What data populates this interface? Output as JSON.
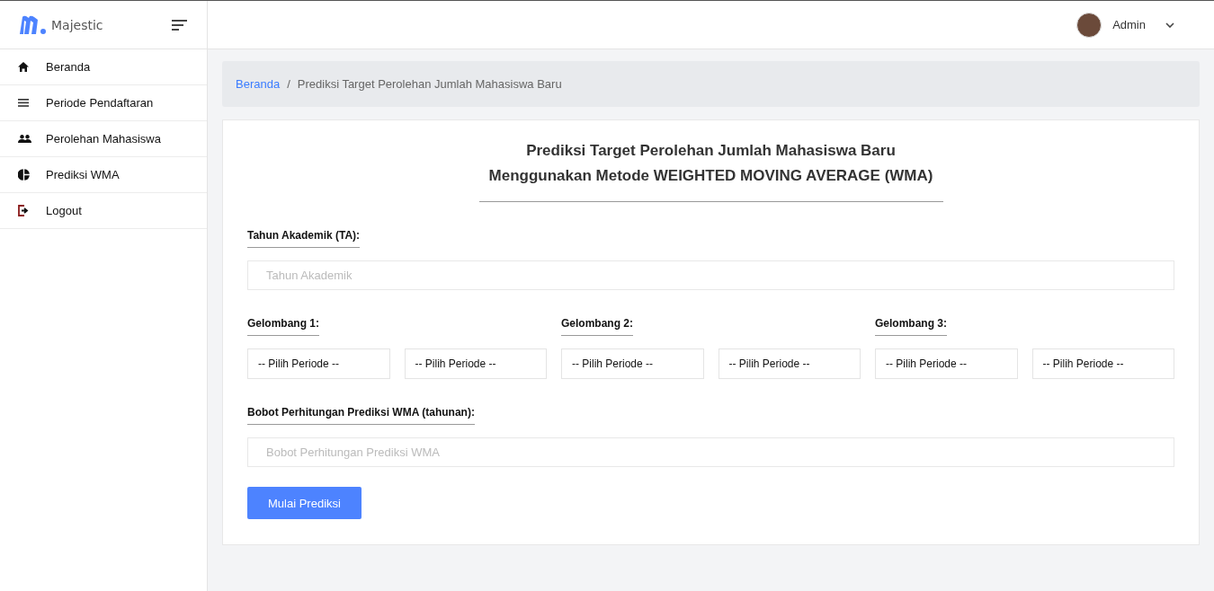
{
  "brand": {
    "name": "Majestic"
  },
  "header": {
    "user": "Admin"
  },
  "sidebar": {
    "items": [
      {
        "label": "Beranda"
      },
      {
        "label": "Periode Pendaftaran"
      },
      {
        "label": "Perolehan Mahasiswa"
      },
      {
        "label": "Prediksi WMA"
      },
      {
        "label": "Logout"
      }
    ]
  },
  "breadcrumb": {
    "link": "Beranda",
    "separator": "/",
    "current": "Prediksi Target Perolehan Jumlah Mahasiswa Baru"
  },
  "form": {
    "title_lines": [
      "Prediksi Target Perolehan Jumlah Mahasiswa Baru",
      "Menggunakan Metode WEIGHTED MOVING AVERAGE (WMA)"
    ],
    "year": {
      "label": "Tahun Akademik (TA):",
      "placeholder": "Tahun Akademik"
    },
    "waves": [
      {
        "label": "Gelombang 1:",
        "selects": [
          "-- Pilih Periode --",
          "-- Pilih Periode --"
        ]
      },
      {
        "label": "Gelombang 2:",
        "selects": [
          "-- Pilih Periode --",
          "-- Pilih Periode --"
        ]
      },
      {
        "label": "Gelombang 3:",
        "selects": [
          "-- Pilih Periode --",
          "-- Pilih Periode --"
        ]
      }
    ],
    "weight": {
      "label": "Bobot Perhitungan Prediksi WMA (tahunan):",
      "placeholder": "Bobot Perhitungan Prediksi WMA"
    },
    "submit": "Mulai Prediksi"
  }
}
